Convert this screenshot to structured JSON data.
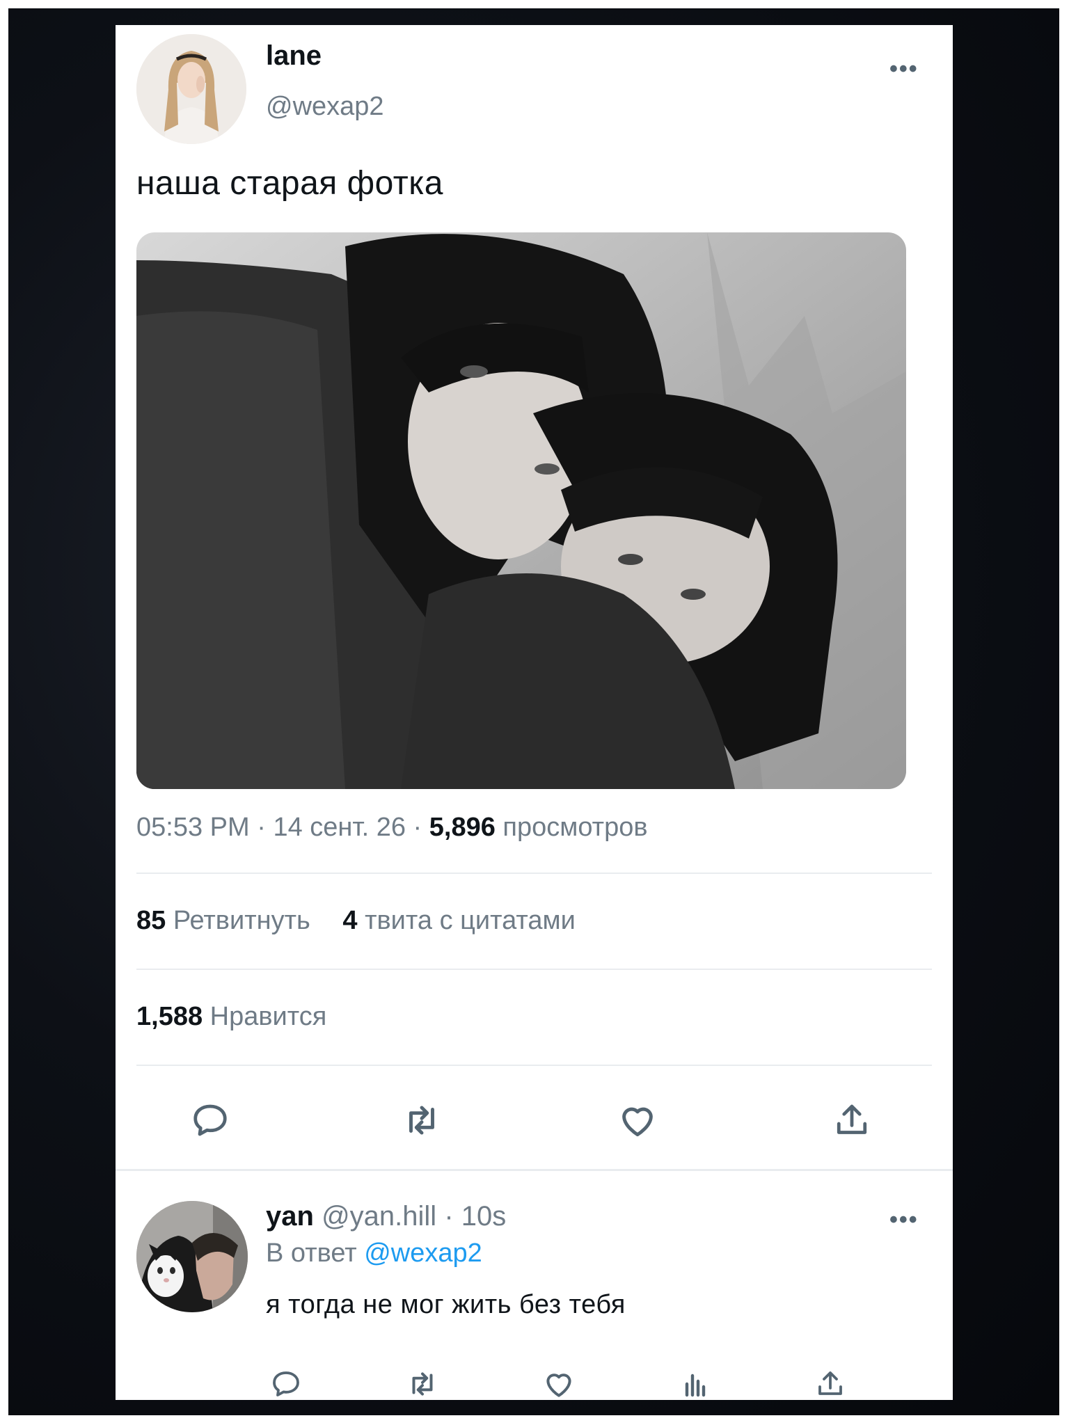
{
  "tweet": {
    "display_name": "lane",
    "handle": "@wexap2",
    "text": "наша старая фотка",
    "meta": {
      "time": "05:53 PM",
      "sep": "·",
      "date": "14 сент. 26",
      "views_count": "5,896",
      "views_label": "просмотров"
    },
    "stats": {
      "retweets_count": "85",
      "retweets_label": "Ретвитнуть",
      "quotes_count": "4",
      "quotes_label": "твита с цитатами",
      "likes_count": "1,588",
      "likes_label": "Нравится"
    },
    "more_icon": "more-horizontal-icon",
    "actions": [
      "reply-icon",
      "retweet-icon",
      "like-icon",
      "share-icon"
    ]
  },
  "reply": {
    "display_name": "yan",
    "handle": "@yan.hill",
    "sep": "·",
    "time": "10s",
    "reply_to_label": "В ответ",
    "reply_to_handle": "@wexap2",
    "text": "я тогда не мог жить без тебя",
    "actions": [
      "reply-icon",
      "retweet-icon",
      "like-icon",
      "analytics-icon",
      "share-icon"
    ]
  },
  "colors": {
    "text_primary": "#0f1419",
    "text_muted": "#6f7b86",
    "link": "#1d9bf0",
    "divider": "#e9ecef",
    "background": "#0b0e13"
  }
}
